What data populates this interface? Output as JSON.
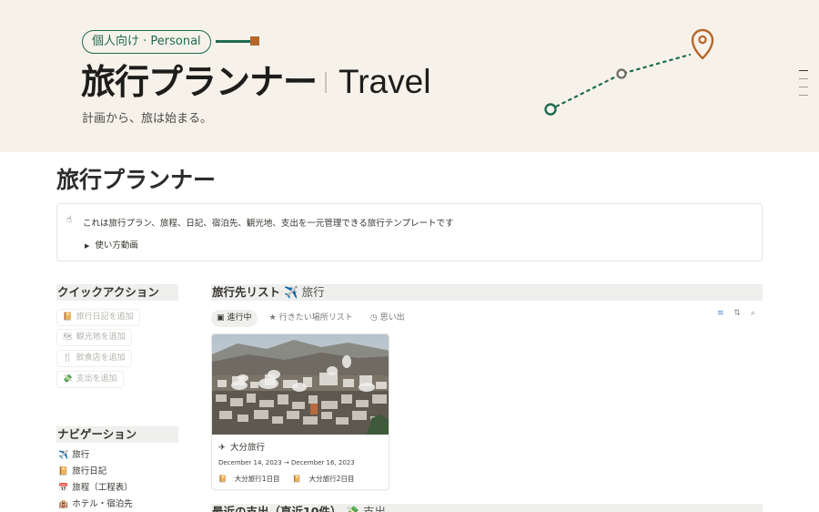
{
  "banner": {
    "badge": "個人向け · Personal",
    "title_ja": "旅行プランナー",
    "title_en": "Travel",
    "subtitle": "計画から、旅は始まる。"
  },
  "page": {
    "title": "旅行プランナー"
  },
  "callout": {
    "icon": "☝",
    "text": "これは旅行プラン、旅程、日記、宿泊先、観光地、支出を一元管理できる旅行テンプレートです",
    "toggle_label": "使い方動画"
  },
  "quick_actions": {
    "heading": "クイックアクション",
    "buttons": [
      {
        "icon": "📔",
        "label": "旅行日記を追加"
      },
      {
        "icon": "🗺",
        "label": "観光地を追加"
      },
      {
        "icon": "🍴",
        "label": "飲食店を追加"
      },
      {
        "icon": "💸",
        "label": "支出を追加"
      }
    ]
  },
  "navigation": {
    "heading": "ナビゲーション",
    "items": [
      {
        "icon": "✈️",
        "label": "旅行"
      },
      {
        "icon": "📔",
        "label": "旅行日記"
      },
      {
        "icon": "📅",
        "label": "旅程（工程表）"
      },
      {
        "icon": "🏨",
        "label": "ホテル・宿泊先"
      }
    ]
  },
  "trips_db": {
    "title": "旅行先リスト",
    "emoji": "✈️",
    "link_label": "旅行",
    "tabs": [
      {
        "icon": "▣",
        "label": "進行中",
        "active": true
      },
      {
        "icon": "★",
        "label": "行きたい場所リスト",
        "active": false
      },
      {
        "icon": "◷",
        "label": "思い出",
        "active": false
      }
    ],
    "tools": {
      "filter": "≡",
      "sort": "⇅",
      "search": "⌕"
    },
    "cards": [
      {
        "icon": "✈",
        "title": "大分旅行",
        "dates": "December 14, 2023 → December 16, 2023",
        "tags": [
          {
            "icon": "📔",
            "label": "大分旅行1日目"
          },
          {
            "icon": "📔",
            "label": "大分旅行2日目"
          }
        ]
      }
    ]
  },
  "expenses_db": {
    "title": "最近の支出（直近10件）",
    "emoji": "💸",
    "link_label": "支出"
  },
  "colors": {
    "banner_bg": "#f6f2ea",
    "accent_green": "#1f6b4f",
    "accent_brown": "#b5672b"
  }
}
